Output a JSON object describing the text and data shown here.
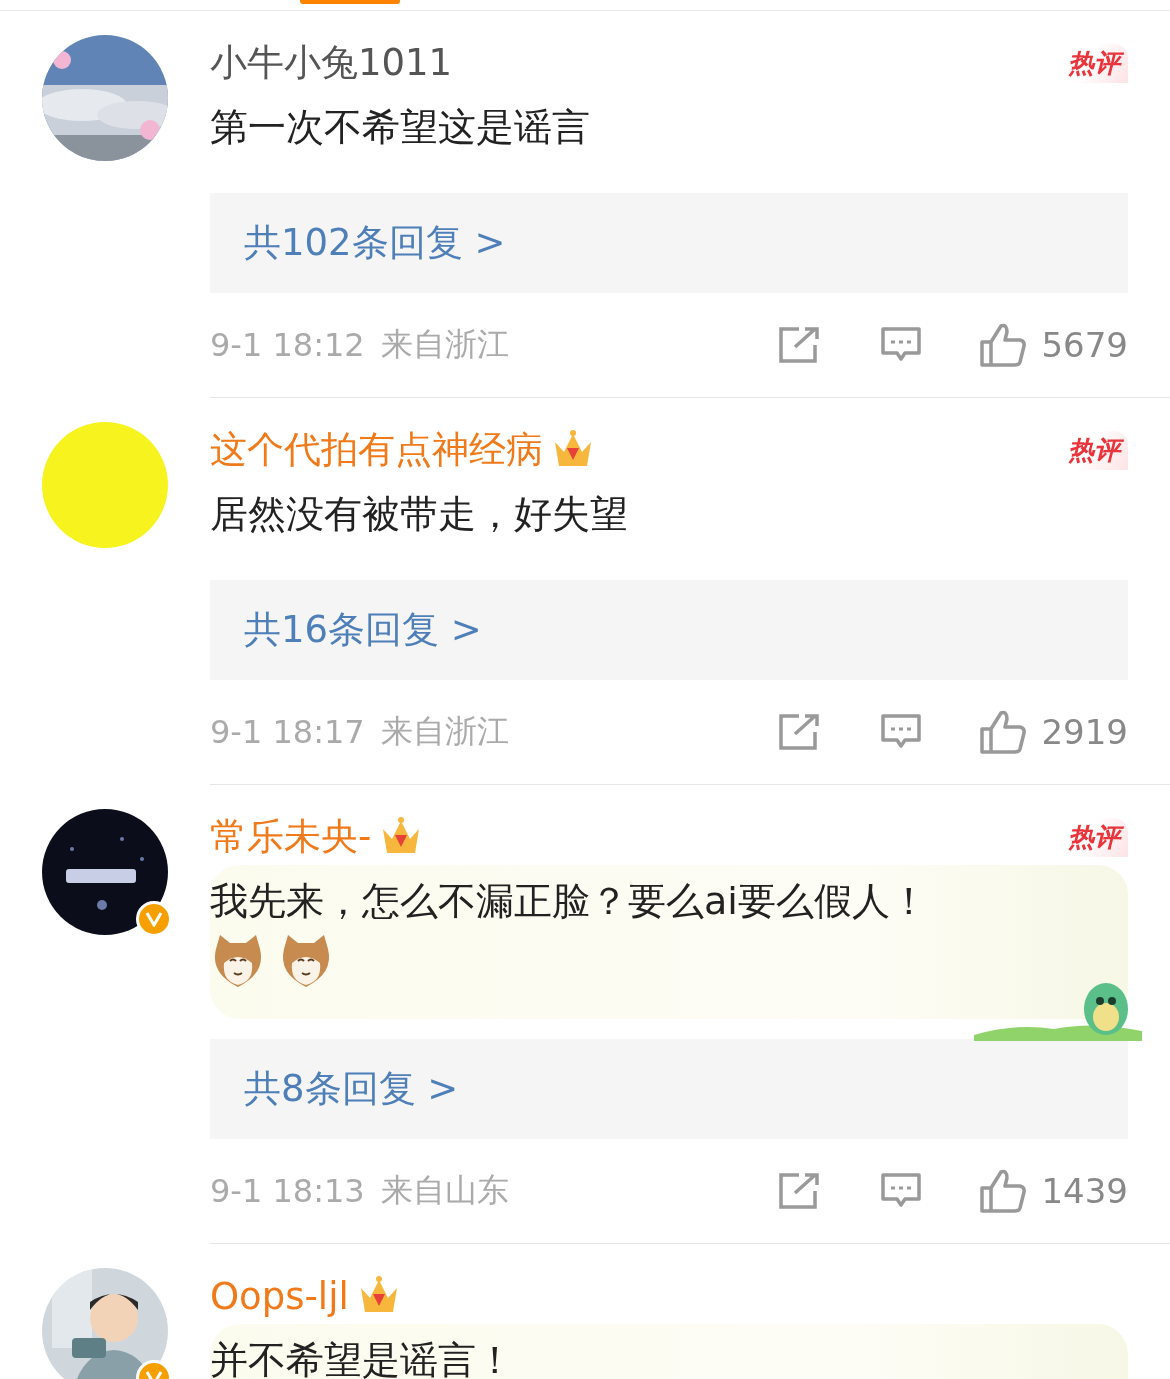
{
  "comments": [
    {
      "name": "小牛小兔1011",
      "vip": false,
      "crown": false,
      "verified": false,
      "hot_badge": "热评",
      "content": "第一次不希望这是谣言",
      "decorated": false,
      "replies": "共102条回复 >",
      "time": "9-1 18:12",
      "location": "来自浙江",
      "likes": "5679"
    },
    {
      "avatar": {
        "kind": "plain",
        "color": "#f7f31e"
      },
      "name": "这个代拍有点神经病",
      "vip": true,
      "crown": true,
      "verified": false,
      "hot_badge": "热评",
      "content": "居然没有被带走，好失望",
      "decorated": false,
      "replies": "共16条回复 >",
      "time": "9-1 18:17",
      "location": "来自浙江",
      "likes": "2919"
    },
    {
      "avatar": {
        "kind": "dark"
      },
      "name": "常乐未央-",
      "vip": true,
      "crown": true,
      "verified": true,
      "hot_badge": "热评",
      "content": "我先来，怎么不漏正脸？要么ai要么假人！",
      "decorated": true,
      "emojis": [
        {
          "kind": "cat"
        },
        {
          "kind": "cat"
        }
      ],
      "replies": "共8条回复 >",
      "time": "9-1 18:13",
      "location": "来自山东",
      "likes": "1439"
    },
    {
      "avatar": {
        "kind": "figure"
      },
      "name": "Oops-ljl",
      "vip": true,
      "crown": true,
      "verified": true,
      "content": "并不希望是谣言！",
      "decorated": true
    }
  ]
}
